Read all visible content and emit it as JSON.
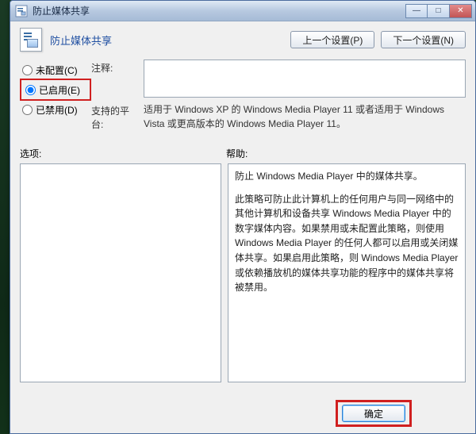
{
  "window": {
    "title": "防止媒体共享"
  },
  "header": {
    "title": "防止媒体共享",
    "prev_button": "上一个设置(P)",
    "next_button": "下一个设置(N)"
  },
  "radios": {
    "not_configured": "未配置(C)",
    "enabled": "已启用(E)",
    "disabled": "已禁用(D)",
    "selected": "enabled"
  },
  "fields": {
    "comment_label": "注释:",
    "comment_value": "",
    "platform_label": "支持的平台:",
    "platform_value": "适用于 Windows XP 的 Windows Media Player 11 或者适用于 Windows Vista 或更高版本的 Windows Media Player 11。"
  },
  "sections": {
    "options_label": "选项:",
    "help_label": "帮助:"
  },
  "help": {
    "p1": "防止 Windows Media Player 中的媒体共享。",
    "p2": "此策略可防止此计算机上的任何用户与同一网络中的其他计算机和设备共享 Windows Media Player 中的数字媒体内容。如果禁用或未配置此策略，则使用 Windows Media Player 的任何人都可以启用或关闭媒体共享。如果启用此策略，则 Windows Media Player 或依赖播放机的媒体共享功能的程序中的媒体共享将被禁用。"
  },
  "footer": {
    "ok": "确定"
  },
  "win_controls": {
    "minimize": "—",
    "maximize": "□",
    "close": "✕"
  },
  "colors": {
    "highlight_box": "#d02020"
  }
}
